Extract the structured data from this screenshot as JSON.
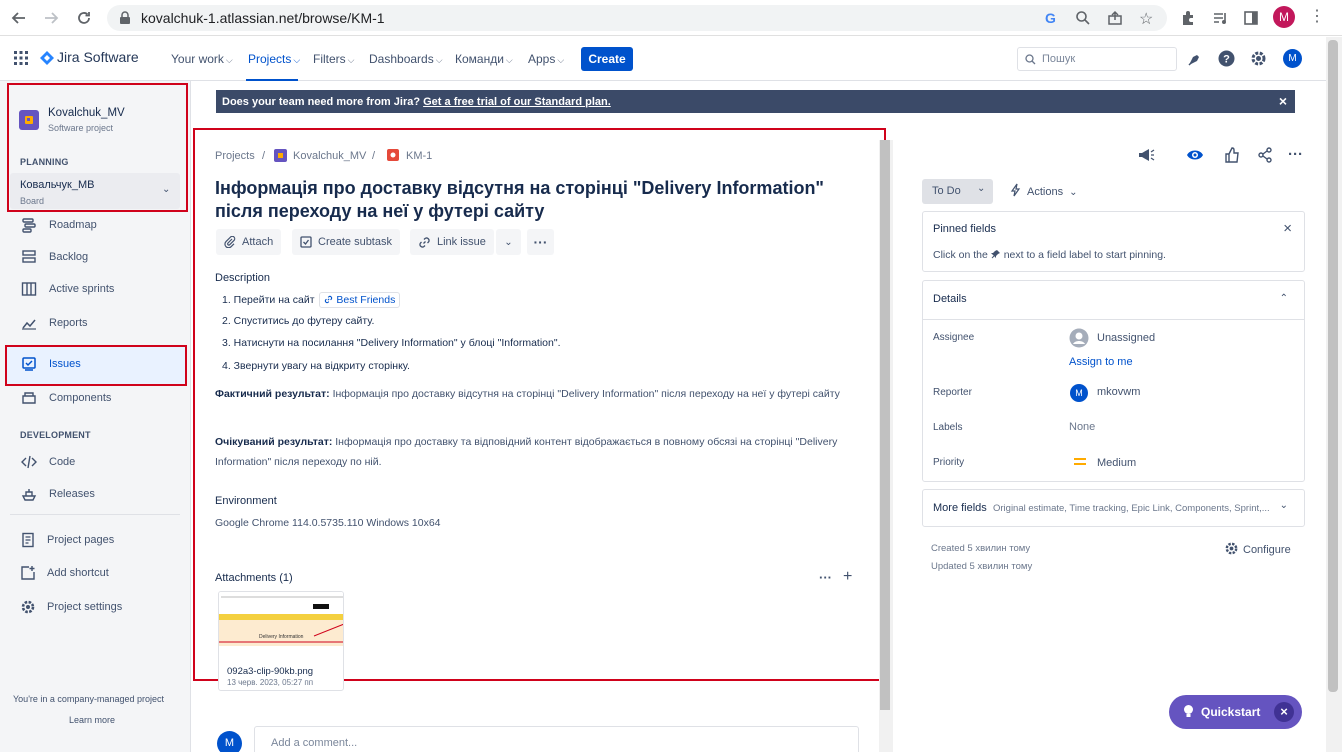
{
  "browser": {
    "url": "kovalchuk-1.atlassian.net/browse/KM-1",
    "profile_initial": "M"
  },
  "topnav": {
    "app_name": "Jira Software",
    "items": [
      "Your work",
      "Projects",
      "Filters",
      "Dashboards",
      "Команди",
      "Apps"
    ],
    "create_label": "Create",
    "search_placeholder": "Пошук",
    "avatar_initial": "M"
  },
  "sidebar": {
    "project_name": "Kovalchuk_MV",
    "project_type": "Software project",
    "planning_label": "PLANNING",
    "board_name": "Ковальчук_МВ",
    "board_sub": "Board",
    "planning_items": [
      "Roadmap",
      "Backlog",
      "Active sprints",
      "Reports"
    ],
    "issues_label": "Issues",
    "components_label": "Components",
    "development_label": "DEVELOPMENT",
    "development_items": [
      "Code",
      "Releases"
    ],
    "bottom_items": [
      "Project pages",
      "Add shortcut",
      "Project settings"
    ],
    "footer_text": "You're in a company-managed project",
    "learn_more": "Learn more"
  },
  "banner": {
    "text": "Does your team need more from Jira?",
    "link": "Get a free trial of our Standard plan.",
    "close": "×"
  },
  "issue": {
    "breadcrumb": [
      "Projects",
      "Kovalchuk_MV",
      "KM-1"
    ],
    "title": "Інформація про доставку відсутня на сторінці \"Delivery Information\" після переходу на неї у футері сайту",
    "toolbar": {
      "attach": "Attach",
      "create_subtask": "Create subtask",
      "link_issue": "Link issue"
    },
    "description_label": "Description",
    "steps": {
      "s1_prefix": "1. Перейти на сайт",
      "s1_link": "Best Friends",
      "s2": "2. Спуститись до футеру сайту.",
      "s3": "3. Натиснути на посилання \"Delivery Information\" у блоці \"Information\".",
      "s4": "4. Звернути увагу на відкриту сторінку."
    },
    "actual_label": "Фактичний результат:",
    "actual_text": "Інформація про доставку відсутня на сторінці \"Delivery Information\" після переходу на неї у футері сайту",
    "expected_label": "Очікуваний результат:",
    "expected_text": "Інформація про доставку та відповідний контент відображається в повному обсязі на сторінці \"Delivery Information\" після переходу по ній.",
    "environment_label": "Environment",
    "environment_value": "Google Chrome 114.0.5735.110 Windows 10x64",
    "attachments_label": "Attachments (1)",
    "attachment": {
      "filename": "092a3-clip-90kb.png",
      "date": "13 черв. 2023, 05:27 пп",
      "thumb_heading": "Delivery Information"
    },
    "comment_avatar": "M",
    "comment_placeholder": "Add a comment..."
  },
  "right_panel": {
    "status": "To Do",
    "actions": "Actions",
    "pinned_title": "Pinned fields",
    "pinned_hint_pre": "Click on the",
    "pinned_hint_post": "next to a field label to start pinning.",
    "details_title": "Details",
    "fields": {
      "assignee_label": "Assignee",
      "assignee_value": "Unassigned",
      "assign_to_me": "Assign to me",
      "reporter_label": "Reporter",
      "reporter_initial": "M",
      "reporter_value": "mkovwm",
      "labels_label": "Labels",
      "labels_value": "None",
      "priority_label": "Priority",
      "priority_value": "Medium"
    },
    "more_fields_title": "More fields",
    "more_fields_list": "Original estimate, Time tracking, Epic Link, Components, Sprint,...",
    "created": "Created 5 хвилин тому",
    "updated": "Updated 5 хвилин тому",
    "configure": "Configure"
  },
  "quickstart": {
    "label": "Quickstart"
  },
  "colors": {
    "accent": "#0052cc",
    "banner": "#3b4a68",
    "highlight_box": "#d0021b",
    "quickstart": "#6554c0",
    "priority_medium": "#ffab00"
  }
}
